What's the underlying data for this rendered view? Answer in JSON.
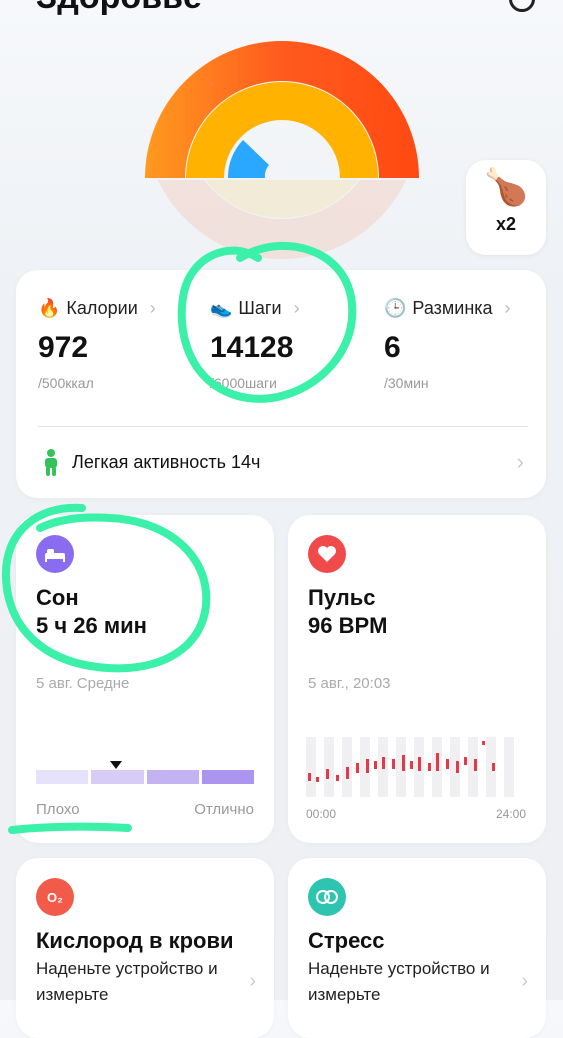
{
  "header": {
    "title": "Здоровье"
  },
  "bonus": {
    "count": "x2"
  },
  "summary": {
    "calories": {
      "label": "Калории",
      "value": "972",
      "goal": "/500ккал"
    },
    "steps": {
      "label": "Шаги",
      "value": "14128",
      "goal": "/6000шаги"
    },
    "warmup": {
      "label": "Разминка",
      "value": "6",
      "goal": "/30мин"
    },
    "activity": {
      "label": "Легкая активность 14ч"
    }
  },
  "sleep": {
    "title": "Сон",
    "value": "5 ч 26 мин",
    "sub": "5 авг. Средне",
    "scale_low": "Плохо",
    "scale_high": "Отлично",
    "colors": [
      "#e7e2fb",
      "#d7ccf7",
      "#c4b3f3",
      "#ac95ee"
    ]
  },
  "pulse": {
    "title": "Пульс",
    "value": "96 BPM",
    "sub": "5 авг., 20:03",
    "t_start": "00:00",
    "t_end": "24:00"
  },
  "oxygen": {
    "title": "Кислород в крови",
    "body": "Наденьте устройство и измерьте"
  },
  "stress": {
    "title": "Стресс",
    "body": "Наденьте устройство и измерьте"
  },
  "colors": {
    "outer_ring": "#ff5a1f",
    "middle_ring": "#ffb300",
    "inner_ring": "#2aa7ff",
    "annotation": "#3bf0a8"
  }
}
